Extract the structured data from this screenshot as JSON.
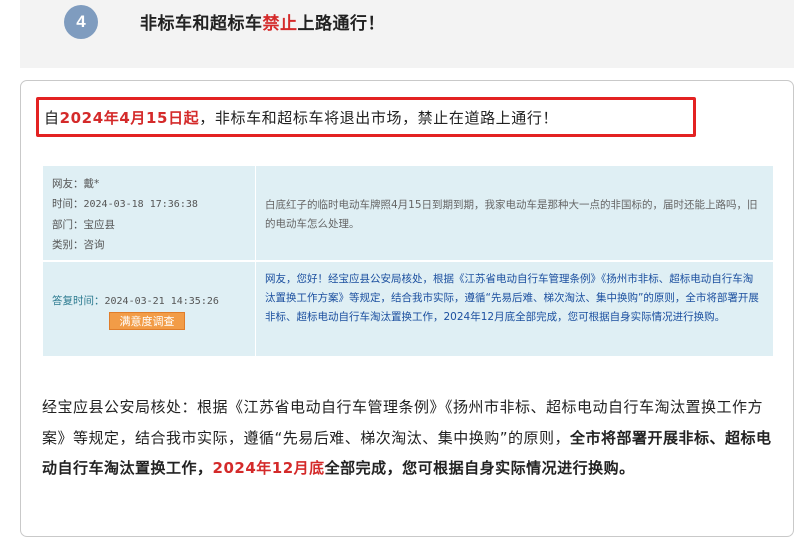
{
  "step": {
    "number": "4",
    "title_part1": "非标车和超标车",
    "title_red": "禁止",
    "title_part2": "上路通行！"
  },
  "highlight": {
    "prefix": "自",
    "date_red": "2024年4月15日起",
    "rest": "，非标车和超标车将退出市场，禁止在道路上通行！"
  },
  "qa": {
    "user": "网友：戴*",
    "time_label": "时间：",
    "time": "2024-03-18 17:36:38",
    "dept": "部门：宝应县",
    "category": "类别：咨询",
    "question": "白底红子的临时电动车牌照4月15日到期到期，我家电动车是那种大一点的非国标的，届时还能上路吗，旧的电动车怎么处理。",
    "reply_time_label": "答复时间：",
    "reply_time": "2024-03-21 14:35:26",
    "survey_button": "满意度调查",
    "answer": "网友，您好！经宝应县公安局核处，根据《江苏省电动自行车管理条例》《扬州市非标、超标电动自行车淘汰置换工作方案》等规定，结合我市实际，遵循“先易后难、梯次淘汰、集中换购”的原则，全市将部署开展非标、超标电动自行车淘汰置换工作，2024年12月底全部完成，您可根据自身实际情况进行换购。"
  },
  "summary": {
    "part1": "经宝应县公安局核处：根据《江苏省电动自行车管理条例》《扬州市非标、超标电动自行车淘汰置换工作方案》等规定，结合我市实际，遵循“先易后难、梯次淘汰、集中换购”的原则，",
    "part2_bold": "全市将部署开展非标、超标电动自行车淘汰置换工作，",
    "part3_red": "2024年12月底",
    "part4_bold": "全部完成，您可根据自身实际情况进行换购。"
  },
  "colors": {
    "accent_red": "#d42a2a",
    "badge": "#7f9cbf",
    "table_bg": "#dfeff4",
    "answer_blue": "#1b4f9f",
    "button_orange": "#f29c47"
  }
}
